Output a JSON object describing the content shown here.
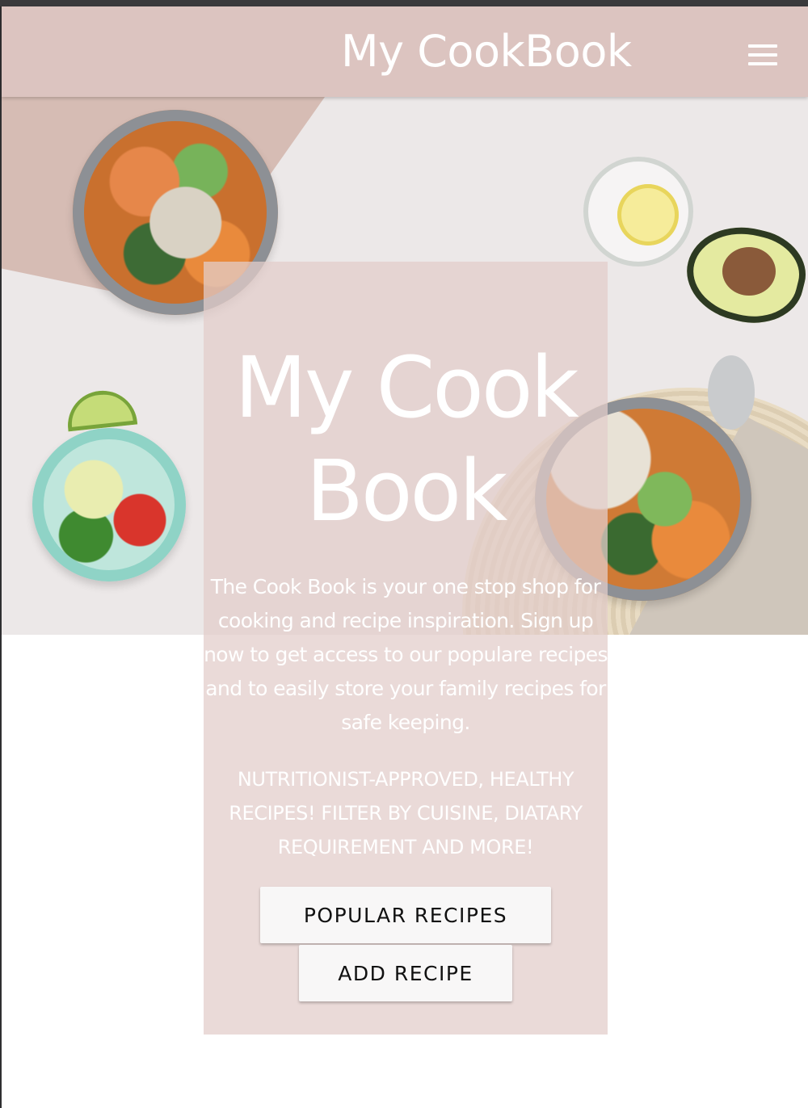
{
  "navbar": {
    "brand": "My CookBook",
    "menu_icon": "hamburger-menu-icon"
  },
  "hero": {
    "image_description_icon": "food-bowls-photo"
  },
  "overlay": {
    "title_line1": "My Cook",
    "title_line2": "Book",
    "intro": "The Cook Book is your one stop shop for cooking and recipe inspiration. Sign up now to get access to our populare recipes and to easily store your family recipes for safe keeping.",
    "tagline": "NUTRITIONIST-APPROVED, HEALTHY RECIPES! FILTER BY CUISINE, DIATARY REQUIREMENT AND MORE!",
    "buttons": {
      "popular": "POPULAR RECIPES",
      "add": "ADD RECIPE"
    }
  },
  "colors": {
    "navbar": "#dcc4c0",
    "overlay": "#e2cdcb",
    "button_bg": "#f8f7f7"
  }
}
